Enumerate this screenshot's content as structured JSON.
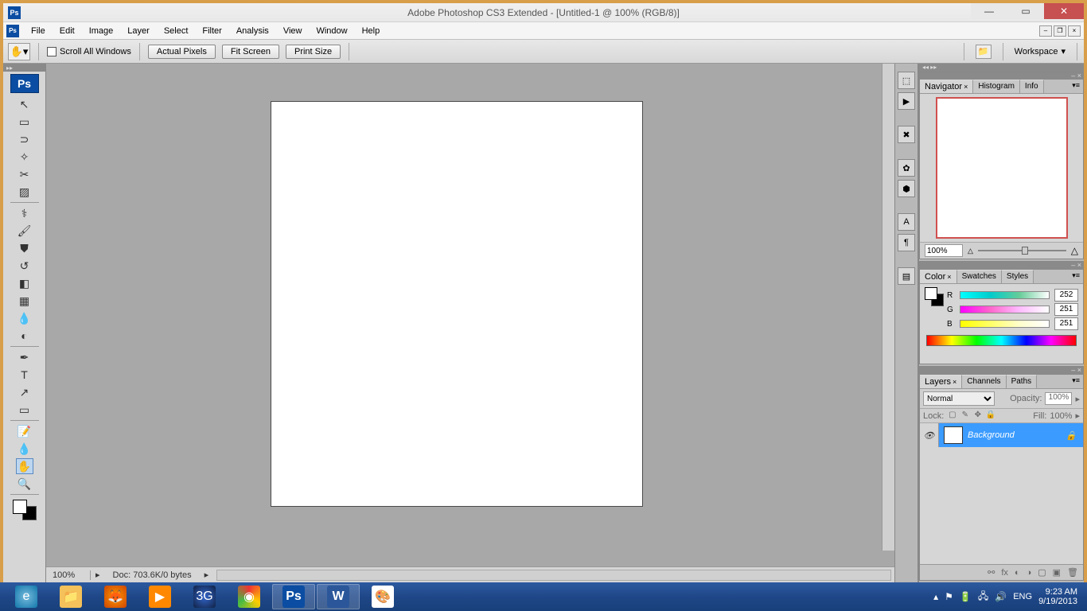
{
  "titlebar": {
    "title": "Adobe Photoshop CS3 Extended - [Untitled-1 @ 100% (RGB/8)]"
  },
  "menubar": {
    "items": [
      "File",
      "Edit",
      "Image",
      "Layer",
      "Select",
      "Filter",
      "Analysis",
      "View",
      "Window",
      "Help"
    ]
  },
  "optionsbar": {
    "scroll_all": "Scroll All Windows",
    "actual_pixels": "Actual Pixels",
    "fit_screen": "Fit Screen",
    "print_size": "Print Size",
    "workspace": "Workspace"
  },
  "statusbar": {
    "zoom": "100%",
    "doc": "Doc: 703.6K/0 bytes"
  },
  "navigator": {
    "tabs": [
      "Navigator",
      "Histogram",
      "Info"
    ],
    "zoom": "100%"
  },
  "color": {
    "tabs": [
      "Color",
      "Swatches",
      "Styles"
    ],
    "r": "252",
    "g": "251",
    "b": "251"
  },
  "layers": {
    "tabs": [
      "Layers",
      "Channels",
      "Paths"
    ],
    "blend": "Normal",
    "opacity_label": "Opacity:",
    "opacity": "100%",
    "lock_label": "Lock:",
    "fill_label": "Fill:",
    "fill": "100%",
    "layer_name": "Background"
  },
  "taskbar": {
    "lang": "ENG",
    "time": "9:23 AM",
    "date": "9/19/2013"
  }
}
